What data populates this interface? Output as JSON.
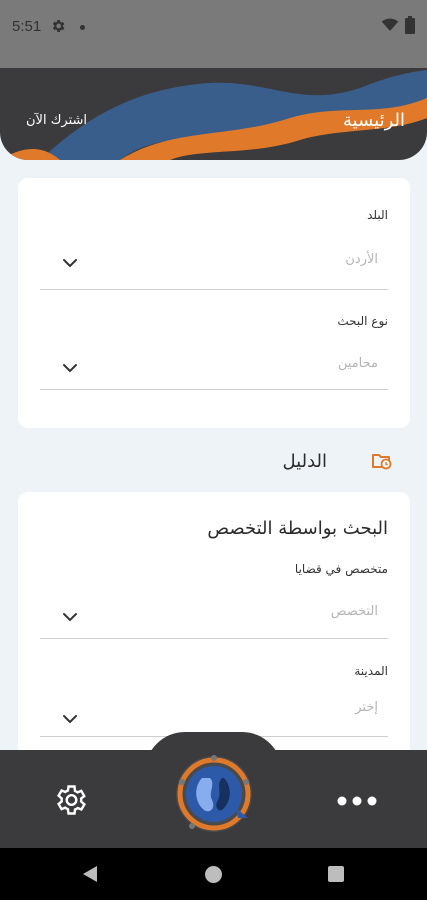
{
  "status_bar": {
    "time": "5:51",
    "icons": [
      "settings-icon",
      "notification-dot",
      "wifi-icon",
      "battery-icon"
    ]
  },
  "header": {
    "title": "الرئيسية",
    "subscribe_label": "اشترك الآن"
  },
  "filter_card": {
    "fields": [
      {
        "label": "البلد",
        "value": "الأردن"
      },
      {
        "label": "نوع البحث",
        "value": "محامين"
      }
    ]
  },
  "section": {
    "title": "الدليل",
    "icon": "folder-clock-icon"
  },
  "specialty_card": {
    "heading": "البحث بواسطة التخصص",
    "fields": [
      {
        "label": "متخصص في قضايا",
        "placeholder": "التخصص"
      },
      {
        "label": "المدينة",
        "placeholder": "إختر"
      }
    ]
  },
  "bottom_bar": {
    "left_icon": "settings-icon",
    "center_icon": "app-logo-icon",
    "right_icon": "more-icon"
  },
  "colors": {
    "header_bg": "#3b3b3d",
    "accent_orange": "#e07a2a",
    "accent_blue": "#3a5e8c",
    "page_bg": "#eef3f8"
  }
}
